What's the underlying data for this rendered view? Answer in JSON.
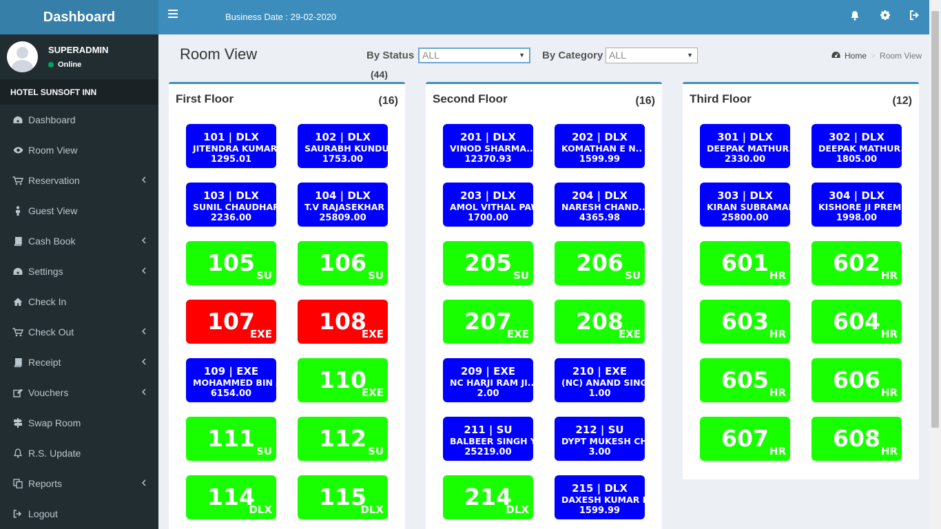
{
  "app": {
    "title": "Dashboard"
  },
  "user": {
    "name": "SUPERADMIN",
    "status": "Online"
  },
  "hotel": {
    "name": "HOTEL SUNSOFT INN"
  },
  "sidebar": {
    "items": [
      {
        "label": "Dashboard",
        "icon": "dashboard-icon"
      },
      {
        "label": "Room View",
        "icon": "eye-icon"
      },
      {
        "label": "Reservation",
        "icon": "cart-icon"
      },
      {
        "label": "Guest View",
        "icon": "person-icon"
      },
      {
        "label": "Cash Book",
        "icon": "book-icon"
      },
      {
        "label": "Settings",
        "icon": "dashboard-icon"
      },
      {
        "label": "Check In",
        "icon": "home-icon"
      },
      {
        "label": "Check Out",
        "icon": "cart-icon"
      },
      {
        "label": "Receipt",
        "icon": "book-icon"
      },
      {
        "label": "Vouchers",
        "icon": "edit-icon"
      },
      {
        "label": "Swap Room",
        "icon": "signpost-icon"
      },
      {
        "label": "R.S. Update",
        "icon": "bell-icon"
      },
      {
        "label": "Reports",
        "icon": "copy-icon"
      },
      {
        "label": "Logout",
        "icon": "sign-out-icon"
      }
    ]
  },
  "header": {
    "business_date": "Business Date : 29-02-2020"
  },
  "page": {
    "title": "Room View",
    "status_label": "By Status :",
    "status_value": "ALL",
    "category_label": "By Category :",
    "category_value": "ALL",
    "total": "(44)"
  },
  "breadcrumb": {
    "home": "Home",
    "current": "Room View"
  },
  "colors": {
    "occupied": "#0000ff",
    "vacant": "#18ff00",
    "dirty": "#ff0000",
    "accent": "#3c8dbc"
  },
  "floors": [
    {
      "name": "First Floor",
      "count": "(16)",
      "rooms": [
        {
          "status": "occupied",
          "line1": "101 | DLX",
          "guest": "JITENDRA KUMAR..",
          "amount": "1295.01"
        },
        {
          "status": "occupied",
          "line1": "102 | DLX",
          "guest": "SAURABH KUNDU..",
          "amount": "1753.00"
        },
        {
          "status": "occupied",
          "line1": "103 | DLX",
          "guest": "SUNIL CHAUDHARY",
          "amount": "2236.00"
        },
        {
          "status": "occupied",
          "line1": "104 | DLX",
          "guest": "T.V RAJASEKHAR ..",
          "amount": "25809.00"
        },
        {
          "status": "vacant",
          "number": "105",
          "category": "SU"
        },
        {
          "status": "vacant",
          "number": "106",
          "category": "SU"
        },
        {
          "status": "dirty",
          "number": "107",
          "category": "EXE"
        },
        {
          "status": "dirty",
          "number": "108",
          "category": "EXE"
        },
        {
          "status": "occupied",
          "line1": "109 | EXE",
          "guest": "MOHAMMED BIN AI",
          "amount": "6154.00"
        },
        {
          "status": "vacant",
          "number": "110",
          "category": "EXE"
        },
        {
          "status": "vacant",
          "number": "111",
          "category": "SU"
        },
        {
          "status": "vacant",
          "number": "112",
          "category": "SU"
        },
        {
          "status": "vacant",
          "number": "114",
          "category": "DLX"
        },
        {
          "status": "vacant",
          "number": "115",
          "category": "DLX"
        }
      ]
    },
    {
      "name": "Second Floor",
      "count": "(16)",
      "rooms": [
        {
          "status": "occupied",
          "line1": "201 | DLX",
          "guest": "VINOD SHARMA..",
          "amount": "12370.93"
        },
        {
          "status": "occupied",
          "line1": "202 | DLX",
          "guest": "KOMATHAN E N..",
          "amount": "1599.99"
        },
        {
          "status": "occupied",
          "line1": "203 | DLX",
          "guest": "AMOL VITHAL PAW",
          "amount": "1700.00"
        },
        {
          "status": "occupied",
          "line1": "204 | DLX",
          "guest": "NARESH CHAND..",
          "amount": "4365.98"
        },
        {
          "status": "vacant",
          "number": "205",
          "category": "SU"
        },
        {
          "status": "vacant",
          "number": "206",
          "category": "SU"
        },
        {
          "status": "vacant",
          "number": "207",
          "category": "EXE"
        },
        {
          "status": "vacant",
          "number": "208",
          "category": "EXE"
        },
        {
          "status": "occupied",
          "line1": "209 | EXE",
          "guest": "NC HARJI RAM JI..",
          "amount": "2.00"
        },
        {
          "status": "occupied",
          "line1": "210 | EXE",
          "guest": "(NC) ANAND SING..",
          "amount": "1.00"
        },
        {
          "status": "occupied",
          "line1": "211 | SU",
          "guest": "BALBEER SINGH Y..",
          "amount": "25219.00"
        },
        {
          "status": "occupied",
          "line1": "212 | SU",
          "guest": "DYPT MUKESH CHA",
          "amount": "3.00"
        },
        {
          "status": "vacant",
          "number": "214",
          "category": "DLX"
        },
        {
          "status": "occupied",
          "line1": "215 | DLX",
          "guest": "DAXESH KUMAR M",
          "amount": "1599.99"
        }
      ]
    },
    {
      "name": "Third Floor",
      "count": "(12)",
      "rooms": [
        {
          "status": "occupied",
          "line1": "301 | DLX",
          "guest": "DEEPAK MATHUR..",
          "amount": "2330.00"
        },
        {
          "status": "occupied",
          "line1": "302 | DLX",
          "guest": "DEEPAK MATHUR..",
          "amount": "1805.00"
        },
        {
          "status": "occupied",
          "line1": "303 | DLX",
          "guest": "KIRAN SUBRAMANI",
          "amount": "25800.00"
        },
        {
          "status": "occupied",
          "line1": "304 | DLX",
          "guest": "KISHORE JI PREM..",
          "amount": "1998.00"
        },
        {
          "status": "vacant",
          "number": "601",
          "category": "HR"
        },
        {
          "status": "vacant",
          "number": "602",
          "category": "HR"
        },
        {
          "status": "vacant",
          "number": "603",
          "category": "HR"
        },
        {
          "status": "vacant",
          "number": "604",
          "category": "HR"
        },
        {
          "status": "vacant",
          "number": "605",
          "category": "HR"
        },
        {
          "status": "vacant",
          "number": "606",
          "category": "HR"
        },
        {
          "status": "vacant",
          "number": "607",
          "category": "HR"
        },
        {
          "status": "vacant",
          "number": "608",
          "category": "HR"
        }
      ]
    }
  ]
}
